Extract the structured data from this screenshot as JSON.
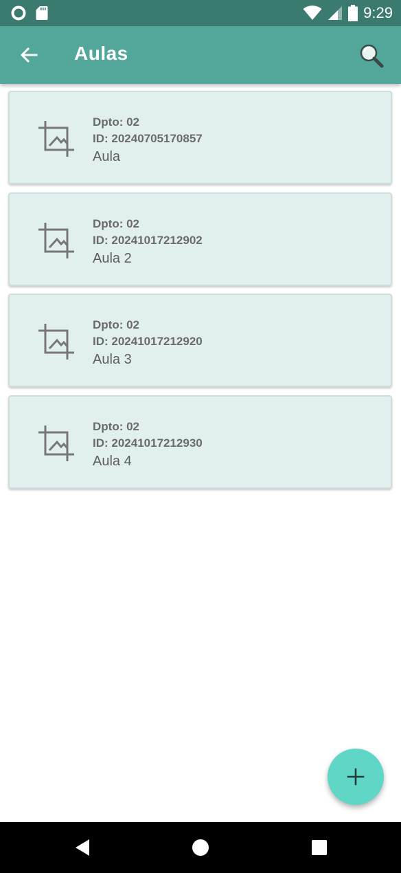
{
  "status_bar": {
    "time": "9:29",
    "left_icons": [
      "sync-circle-icon",
      "sd-card-icon"
    ],
    "right_icons": [
      "wifi-icon",
      "cell-signal-icon",
      "battery-icon"
    ]
  },
  "app_bar": {
    "title": "Aulas",
    "background": "#53a69a",
    "back_icon": "arrow-back-icon",
    "search_icon": "search-icon"
  },
  "items": [
    {
      "dept": "Dpto: 02",
      "id": "ID: 20240705170857",
      "name": "Aula",
      "icon": "crop-image-icon"
    },
    {
      "dept": "Dpto: 02",
      "id": "ID: 20241017212902",
      "name": "Aula 2",
      "icon": "crop-image-icon"
    },
    {
      "dept": "Dpto: 02",
      "id": "ID: 20241017212920",
      "name": "Aula 3",
      "icon": "crop-image-icon"
    },
    {
      "dept": "Dpto: 02",
      "id": "ID: 20241017212930",
      "name": "Aula 4",
      "icon": "crop-image-icon"
    }
  ],
  "fab": {
    "icon": "plus-icon",
    "color": "#5fd6c6"
  },
  "nav_bar": {
    "icons": [
      "nav-back-icon",
      "nav-home-icon",
      "nav-recents-icon"
    ]
  },
  "colors": {
    "status_bar": "#3b7a6f",
    "card_background": "#e1efee",
    "text_secondary": "#6b6b6b"
  }
}
